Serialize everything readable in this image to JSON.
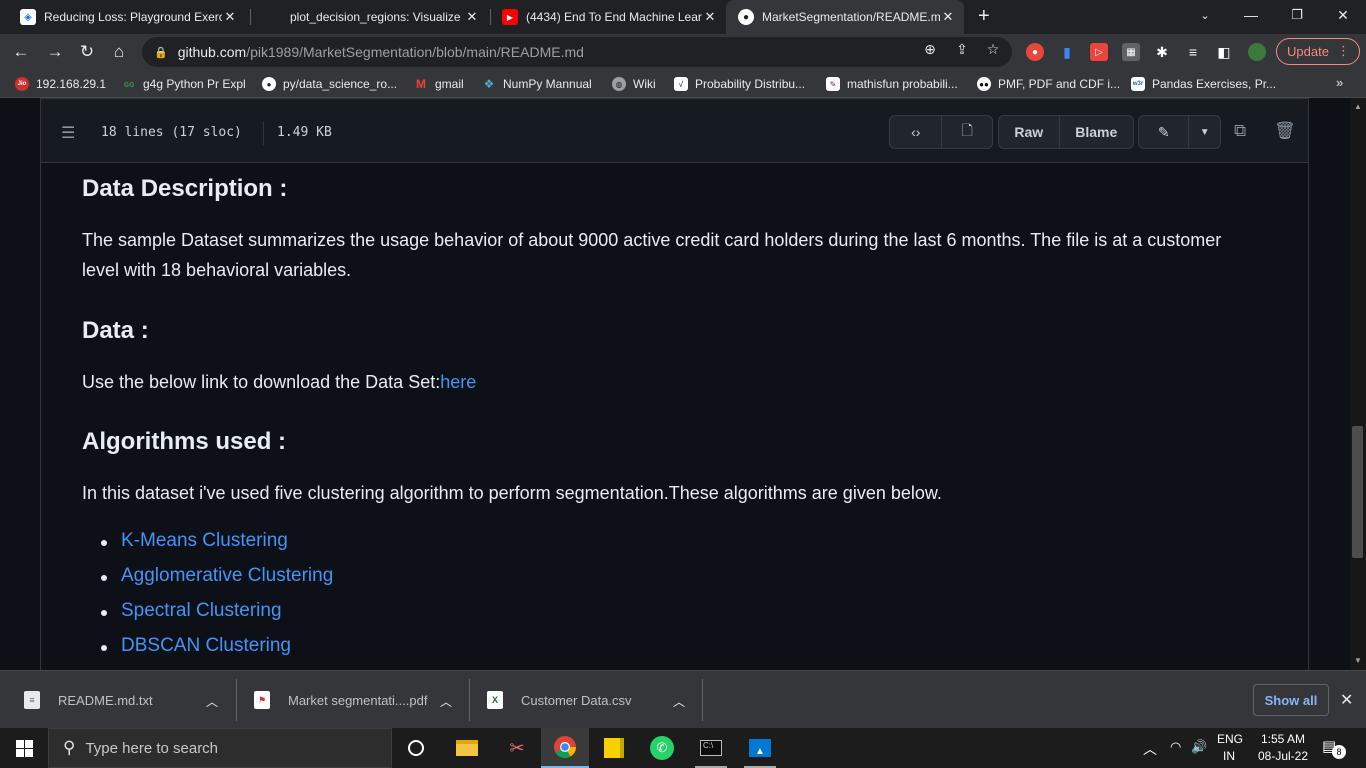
{
  "tabs": [
    {
      "title": "Reducing Loss: Playground Exerc",
      "favicon": "playground-icon",
      "active": false
    },
    {
      "title": "plot_decision_regions: Visualize t",
      "favicon": "mlxtend-icon",
      "active": false
    },
    {
      "title": "(4434) End To End Machine Learn",
      "favicon": "youtube-icon",
      "active": false
    },
    {
      "title": "MarketSegmentation/README.m",
      "favicon": "github-icon",
      "active": true
    }
  ],
  "toolbar": {
    "url_host": "github.com",
    "url_path": "/pik1989/MarketSegmentation/blob/main/README.md",
    "update_label": "Update"
  },
  "bookmarks": [
    {
      "label": "192.168.29.1",
      "icon": "jio-icon"
    },
    {
      "label": "g4g Python Pr Expl",
      "icon": "g4g-icon"
    },
    {
      "label": "py/data_science_ro...",
      "icon": "github-icon"
    },
    {
      "label": "gmail",
      "icon": "gmail-icon"
    },
    {
      "label": "NumPy Mannual",
      "icon": "numpy-icon"
    },
    {
      "label": "Wiki",
      "icon": "globe-icon"
    },
    {
      "label": "Probability Distribu...",
      "icon": "chart-icon"
    },
    {
      "label": "mathisfun probabili...",
      "icon": "math-icon"
    },
    {
      "label": "PMF, PDF and CDF i...",
      "icon": "medium-icon"
    },
    {
      "label": "Pandas Exercises, Pr...",
      "icon": "w3r-icon"
    }
  ],
  "file_header": {
    "lines": "18 lines (17 sloc)",
    "size": "1.49 KB",
    "raw_label": "Raw",
    "blame_label": "Blame"
  },
  "readme": {
    "data_description_heading": "Data Description :",
    "data_description_text": "The sample Dataset summarizes the usage behavior of about 9000 active credit card holders during the last 6 months. The file is at a customer level with 18 behavioral variables.",
    "data_heading": "Data :",
    "data_text": "Use the below link to download the Data Set:",
    "data_link": "here",
    "algorithms_heading": "Algorithms used :",
    "algorithms_text": "In this dataset i've used five clustering algorithm to perform segmentation.These algorithms are given below.",
    "algorithms": [
      "K-Means Clustering",
      "Agglomerative Clustering",
      "Spectral Clustering",
      "DBSCAN Clustering"
    ]
  },
  "downloads": [
    {
      "name": "README.md.txt",
      "icon": "text-file-icon"
    },
    {
      "name": "Market segmentati....pdf",
      "icon": "pdf-file-icon"
    },
    {
      "name": "Customer Data.csv",
      "icon": "excel-file-icon"
    }
  ],
  "downloads_show_all": "Show all",
  "taskbar": {
    "search_placeholder": "Type here to search",
    "lang_top": "ENG",
    "lang_bottom": "IN",
    "time": "1:55 AM",
    "date": "08-Jul-22",
    "notification_count": "8"
  }
}
